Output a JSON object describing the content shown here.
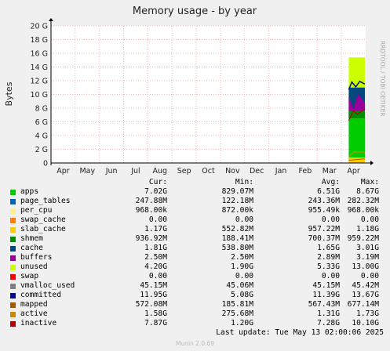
{
  "chart_data": {
    "type": "area",
    "title": "Memory usage - by year",
    "ylabel": "Bytes",
    "side_text": "RRDTOOL / TOBI OETIKER",
    "y_ticks": [
      "0",
      "2 G",
      "4 G",
      "6 G",
      "8 G",
      "10 G",
      "12 G",
      "14 G",
      "16 G",
      "18 G",
      "20 G"
    ],
    "ylim": [
      0,
      20
    ],
    "x_ticks": [
      "Apr",
      "May",
      "Jun",
      "Jul",
      "Aug",
      "Sep",
      "Oct",
      "Nov",
      "Dec",
      "Jan",
      "Feb",
      "Mar",
      "Apr"
    ],
    "grid": true,
    "data_start_month_index": 12.3,
    "stack_estimate_gb": {
      "apps": 6.5,
      "cache_shmem_buffers": 4.5,
      "unused_top": 15.4,
      "committed_line": 11.5
    },
    "columns": [
      "Cur:",
      "Min:",
      "Avg:",
      "Max:"
    ],
    "series": [
      {
        "name": "apps",
        "color": "#00cc00",
        "cur": "7.02G",
        "min": "829.07M",
        "avg": "6.51G",
        "max": "8.67G"
      },
      {
        "name": "page_tables",
        "color": "#0066b3",
        "cur": "247.88M",
        "min": "122.18M",
        "avg": "243.36M",
        "max": "282.32M"
      },
      {
        "name": "per_cpu",
        "color": "#ffed99",
        "cur": "968.00k",
        "min": "872.00k",
        "avg": "955.49k",
        "max": "968.00k"
      },
      {
        "name": "swap_cache",
        "color": "#ff8000",
        "cur": "0.00",
        "min": "0.00",
        "avg": "0.00",
        "max": "0.00"
      },
      {
        "name": "slab_cache",
        "color": "#ffcc00",
        "cur": "1.17G",
        "min": "552.82M",
        "avg": "957.22M",
        "max": "1.18G"
      },
      {
        "name": "shmem",
        "color": "#008f00",
        "cur": "936.92M",
        "min": "188.41M",
        "avg": "700.37M",
        "max": "959.22M"
      },
      {
        "name": "cache",
        "color": "#00487d",
        "cur": "1.81G",
        "min": "538.80M",
        "avg": "1.65G",
        "max": "3.01G"
      },
      {
        "name": "buffers",
        "color": "#990099",
        "cur": "2.50M",
        "min": "2.50M",
        "avg": "2.89M",
        "max": "3.19M"
      },
      {
        "name": "unused",
        "color": "#ccff00",
        "cur": "4.20G",
        "min": "1.90G",
        "avg": "5.33G",
        "max": "13.00G"
      },
      {
        "name": "swap",
        "color": "#ff0000",
        "cur": "0.00",
        "min": "0.00",
        "avg": "0.00",
        "max": "0.00"
      },
      {
        "name": "vmalloc_used",
        "color": "#808080",
        "cur": "45.15M",
        "min": "45.06M",
        "avg": "45.15M",
        "max": "45.42M"
      },
      {
        "name": "committed",
        "color": "#000e8c",
        "cur": "11.95G",
        "min": "5.08G",
        "avg": "11.39G",
        "max": "13.67G"
      },
      {
        "name": "mapped",
        "color": "#a35c00",
        "cur": "572.08M",
        "min": "185.81M",
        "avg": "567.43M",
        "max": "677.14M"
      },
      {
        "name": "active",
        "color": "#c88a00",
        "cur": "1.58G",
        "min": "275.68M",
        "avg": "1.31G",
        "max": "1.73G"
      },
      {
        "name": "inactive",
        "color": "#b30000",
        "cur": "7.87G",
        "min": "1.20G",
        "avg": "7.28G",
        "max": "10.10G"
      }
    ]
  },
  "last_update": "Last update: Tue May 13 02:00:06 2025",
  "footer": "Munin 2.0.69"
}
